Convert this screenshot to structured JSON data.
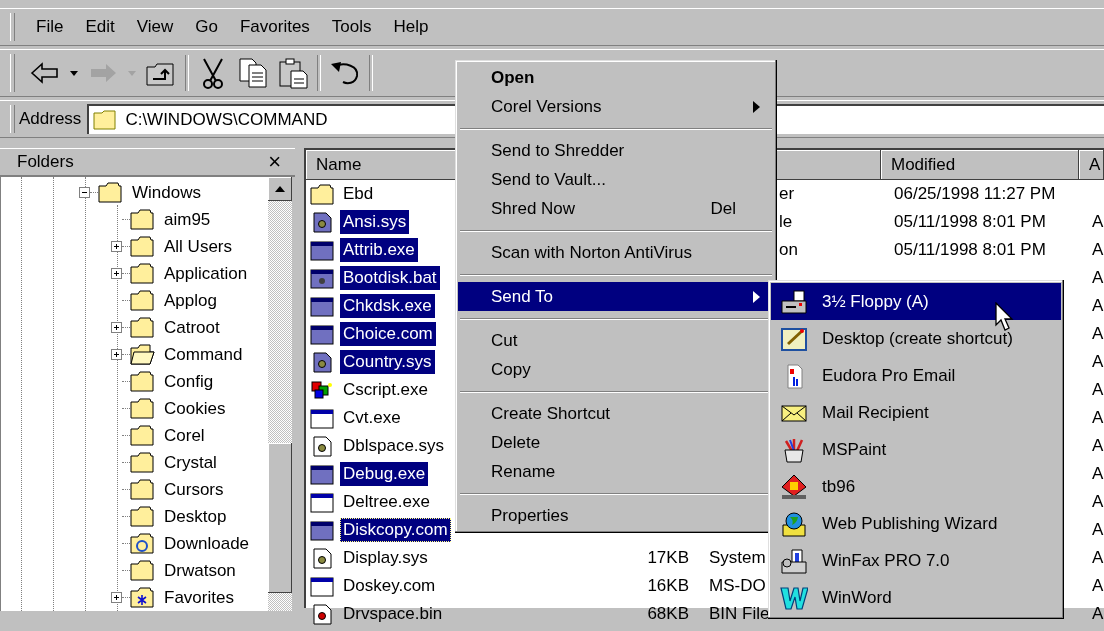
{
  "menu_bar": [
    "File",
    "Edit",
    "View",
    "Go",
    "Favorites",
    "Tools",
    "Help"
  ],
  "toolbar": [
    {
      "kind": "back",
      "disabled": false
    },
    {
      "kind": "dropdown",
      "disabled": false
    },
    {
      "kind": "forward",
      "disabled": true
    },
    {
      "kind": "dropdown",
      "disabled": true
    },
    {
      "kind": "up",
      "disabled": false
    },
    {
      "kind": "separator"
    },
    {
      "kind": "cut",
      "disabled": false
    },
    {
      "kind": "copy",
      "disabled": false
    },
    {
      "kind": "paste",
      "disabled": false
    },
    {
      "kind": "separator"
    },
    {
      "kind": "undo",
      "disabled": false
    },
    {
      "kind": "separator"
    }
  ],
  "address": {
    "label": "Address",
    "value": "C:\\WINDOWS\\COMMAND"
  },
  "folders": {
    "title": "Folders",
    "close": "×",
    "tree": [
      {
        "label": "Windows",
        "kind": "folder",
        "expanded": true,
        "children": [
          {
            "label": "aim95",
            "kind": "folder"
          },
          {
            "label": "All Users",
            "kind": "folder",
            "expanded": false
          },
          {
            "label": "Application",
            "kind": "folder",
            "expanded": false
          },
          {
            "label": "Applog",
            "kind": "folder"
          },
          {
            "label": "Catroot",
            "kind": "folder",
            "expanded": false
          },
          {
            "label": "Command",
            "kind": "open-folder",
            "expanded": false
          },
          {
            "label": "Config",
            "kind": "folder"
          },
          {
            "label": "Cookies",
            "kind": "folder"
          },
          {
            "label": "Corel",
            "kind": "folder"
          },
          {
            "label": "Crystal",
            "kind": "folder"
          },
          {
            "label": "Cursors",
            "kind": "folder"
          },
          {
            "label": "Desktop",
            "kind": "folder"
          },
          {
            "label": "Downloade",
            "kind": "web-folder"
          },
          {
            "label": "Drwatson",
            "kind": "folder"
          },
          {
            "label": "Favorites",
            "kind": "star-folder",
            "expanded": false
          }
        ]
      }
    ]
  },
  "file_list": {
    "columns": [
      {
        "label": "Name"
      },
      {
        "label": "Modified"
      },
      {
        "label": "A"
      }
    ],
    "rows": [
      {
        "name": "Ebd",
        "kind": "folder",
        "selected": false,
        "focused": false,
        "type": "er",
        "modified": "06/25/1998 11:27 PM"
      },
      {
        "name": "Ansi.sys",
        "kind": "sys",
        "selected": true,
        "focused": false,
        "type": "le",
        "modified": "05/11/1998 8:01 PM",
        "attributes": "A"
      },
      {
        "name": "Attrib.exe",
        "kind": "exe",
        "selected": true,
        "focused": false,
        "type": "on",
        "modified": "05/11/1998 8:01 PM",
        "attributes": "A"
      },
      {
        "name": "Bootdisk.bat",
        "kind": "bat",
        "selected": true,
        "focused": false,
        "attributes": "A"
      },
      {
        "name": "Chkdsk.exe",
        "kind": "exe",
        "selected": true,
        "focused": false,
        "attributes": "A"
      },
      {
        "name": "Choice.com",
        "kind": "exe",
        "selected": true,
        "focused": false,
        "attributes": "A"
      },
      {
        "name": "Country.sys",
        "kind": "sys",
        "selected": true,
        "focused": false,
        "attributes": "A"
      },
      {
        "name": "Cscript.exe",
        "kind": "script",
        "selected": false,
        "focused": false,
        "attributes": "A"
      },
      {
        "name": "Cvt.exe",
        "kind": "exe",
        "selected": false,
        "focused": false,
        "attributes": "A"
      },
      {
        "name": "Dblspace.sys",
        "kind": "sys",
        "selected": false,
        "focused": false,
        "attributes": "A"
      },
      {
        "name": "Debug.exe",
        "kind": "exe",
        "selected": true,
        "focused": false,
        "attributes": "A"
      },
      {
        "name": "Deltree.exe",
        "kind": "exe",
        "selected": false,
        "focused": false,
        "attributes": "A"
      },
      {
        "name": "Diskcopy.com",
        "kind": "exe",
        "selected": true,
        "focused": true,
        "attributes": "A"
      },
      {
        "name": "Display.sys",
        "kind": "sys",
        "selected": false,
        "focused": false,
        "size": "17KB",
        "type": "System",
        "attributes": "A"
      },
      {
        "name": "Doskey.com",
        "kind": "exe",
        "selected": false,
        "focused": false,
        "size": "16KB",
        "type": "MS-DO",
        "attributes": "A"
      },
      {
        "name": "Drvspace.bin",
        "kind": "bin",
        "selected": false,
        "focused": false,
        "size": "68KB",
        "type": "BIN File",
        "attributes": "A"
      }
    ]
  },
  "context_menu": [
    {
      "kind": "item",
      "label": "Open",
      "default": true,
      "submenu": false,
      "selected": false
    },
    {
      "kind": "item",
      "label": "Corel Versions",
      "default": false,
      "submenu": true,
      "selected": false
    },
    {
      "kind": "separator"
    },
    {
      "kind": "item",
      "label": "Send to Shredder",
      "default": false,
      "submenu": false,
      "selected": false
    },
    {
      "kind": "item",
      "label": "Send to Vault...",
      "default": false,
      "submenu": false,
      "selected": false
    },
    {
      "kind": "item",
      "label": "Shred Now",
      "shortcut": "Del",
      "default": false,
      "submenu": false,
      "selected": false
    },
    {
      "kind": "separator"
    },
    {
      "kind": "item",
      "label": "Scan with Norton AntiVirus",
      "default": false,
      "submenu": false,
      "selected": false
    },
    {
      "kind": "separator"
    },
    {
      "kind": "item",
      "label": "Send To",
      "default": false,
      "submenu": true,
      "selected": true
    },
    {
      "kind": "separator"
    },
    {
      "kind": "item",
      "label": "Cut",
      "default": false,
      "submenu": false,
      "selected": false
    },
    {
      "kind": "item",
      "label": "Copy",
      "default": false,
      "submenu": false,
      "selected": false
    },
    {
      "kind": "separator"
    },
    {
      "kind": "item",
      "label": "Create Shortcut",
      "default": false,
      "submenu": false,
      "selected": false
    },
    {
      "kind": "item",
      "label": "Delete",
      "default": false,
      "submenu": false,
      "selected": false
    },
    {
      "kind": "item",
      "label": "Rename",
      "default": false,
      "submenu": false,
      "selected": false
    },
    {
      "kind": "separator"
    },
    {
      "kind": "item",
      "label": "Properties",
      "default": false,
      "submenu": false,
      "selected": false
    }
  ],
  "send_to_menu": [
    {
      "label": "3½ Floppy (A)",
      "kind": "floppy",
      "selected": true
    },
    {
      "label": "Desktop (create shortcut)",
      "kind": "desktop",
      "selected": false
    },
    {
      "label": "Eudora Pro Email",
      "kind": "eudora",
      "selected": false
    },
    {
      "label": "Mail Recipient",
      "kind": "mail",
      "selected": false
    },
    {
      "label": "MSPaint",
      "kind": "paint",
      "selected": false
    },
    {
      "label": "tb96",
      "kind": "tb96",
      "selected": false
    },
    {
      "label": "Web Publishing Wizard",
      "kind": "web",
      "selected": false
    },
    {
      "label": "WinFax PRO 7.0",
      "kind": "fax",
      "selected": false
    },
    {
      "label": "WinWord",
      "kind": "word",
      "selected": false
    }
  ]
}
